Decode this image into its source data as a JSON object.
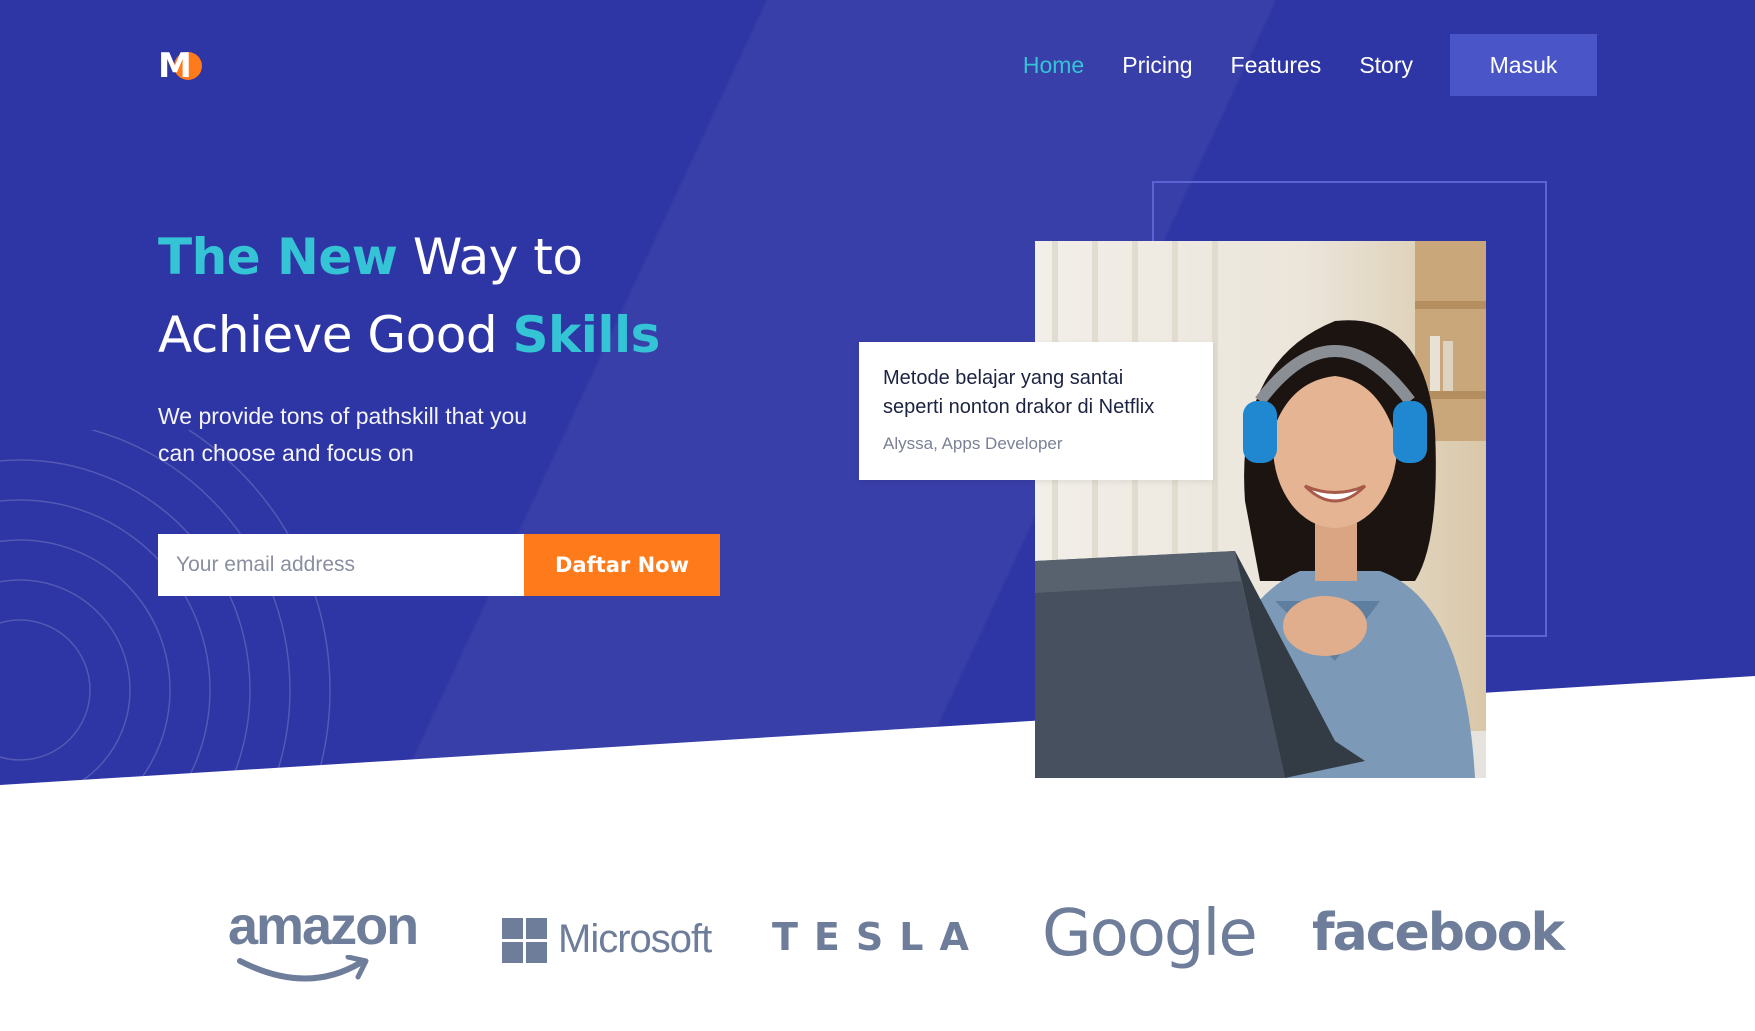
{
  "brand": {
    "logo_letter": "M"
  },
  "nav": {
    "items": [
      {
        "label": "Home",
        "active": true
      },
      {
        "label": "Pricing",
        "active": false
      },
      {
        "label": "Features",
        "active": false
      },
      {
        "label": "Story",
        "active": false
      }
    ],
    "login_label": "Masuk"
  },
  "hero": {
    "headline": {
      "line1_accent": "The New",
      "line1_rest": "Way to",
      "line2_rest": "Achieve Good",
      "line2_accent": "Skills"
    },
    "subtitle_line1": "We provide tons of pathskill that you",
    "subtitle_line2": "can choose and focus on",
    "email_placeholder": "Your email address",
    "cta_label": "Daftar Now"
  },
  "testimonial": {
    "quote_line1": "Metode belajar yang santai",
    "quote_line2": "seperti nonton drakor di Netflix",
    "author": "Alyssa, Apps Developer"
  },
  "partners": {
    "amazon": "amazon",
    "microsoft": "Microsoft",
    "tesla": "TESLA",
    "google": "Google",
    "facebook": "facebook"
  },
  "colors": {
    "hero_bg": "#2e35a4",
    "accent_teal": "#35c4d6",
    "accent_orange": "#ff7a1a",
    "login_button": "#4a55c8",
    "logo_gray": "#6e7d9a"
  }
}
